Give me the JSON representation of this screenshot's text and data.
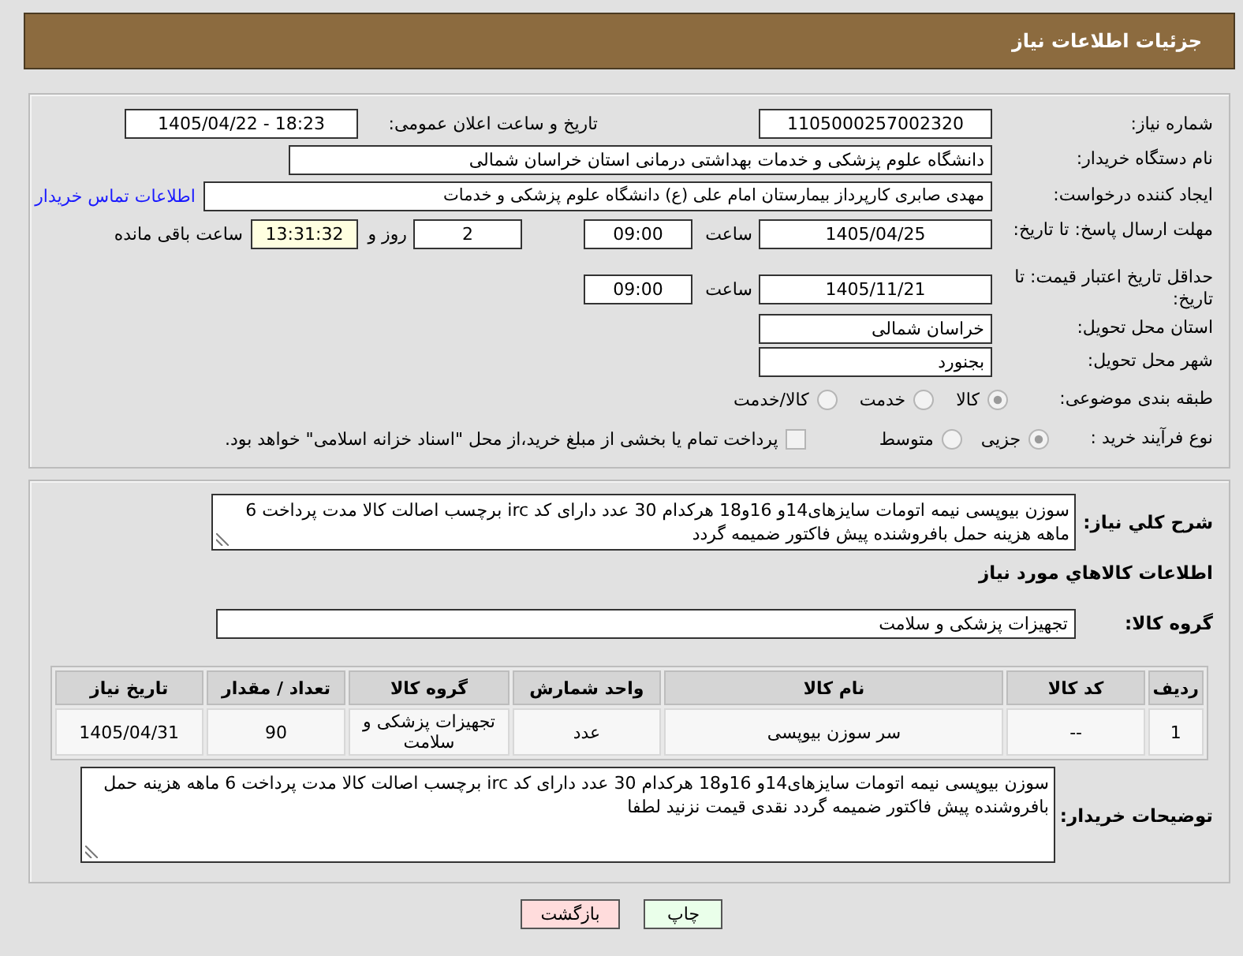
{
  "header": {
    "title": "جزئیات اطلاعات نیاز"
  },
  "details": {
    "need_number": {
      "label": "شماره نیاز:",
      "value": "1105000257002320"
    },
    "announce_datetime": {
      "label": "تاریخ و ساعت اعلان عمومی:",
      "value": "1405/04/22 - 18:23"
    },
    "buyer_org": {
      "label": "نام دستگاه خریدار:",
      "value": "دانشگاه علوم پزشکی و خدمات بهداشتی درمانی استان خراسان شمالی"
    },
    "requester": {
      "label": "ایجاد کننده درخواست:",
      "value": "مهدی صابری کارپرداز بیمارستان امام علی (ع) دانشگاه علوم پزشکی و خدمات",
      "contact_link": "اطلاعات تماس خریدار"
    },
    "response_deadline": {
      "label": "مهلت ارسال پاسخ: تا تاریخ:",
      "date": "1405/04/25",
      "time_label": "ساعت",
      "time": "09:00",
      "days": "2",
      "days_label": "روز و",
      "remaining": "13:31:32",
      "remaining_label": "ساعت باقی مانده"
    },
    "price_validity": {
      "label": "حداقل تاریخ اعتبار قیمت: تا تاریخ:",
      "date": "1405/11/21",
      "time_label": "ساعت",
      "time": "09:00"
    },
    "delivery_province": {
      "label": "استان محل تحویل:",
      "value": "خراسان شمالی"
    },
    "delivery_city": {
      "label": "شهر محل تحویل:",
      "value": "بجنورد"
    },
    "category": {
      "label": "طبقه بندی موضوعی:",
      "options": [
        {
          "label": "کالا",
          "selected": true
        },
        {
          "label": "خدمت",
          "selected": false
        },
        {
          "label": "کالا/خدمت",
          "selected": false
        }
      ]
    },
    "purchase_type": {
      "label": "نوع فرآیند خرید :",
      "options": [
        {
          "label": "جزیی",
          "selected": true
        },
        {
          "label": "متوسط",
          "selected": false
        }
      ],
      "treasury_payment": {
        "label": "پرداخت تمام یا بخشی از مبلغ خرید،از محل \"اسناد خزانه اسلامی\" خواهد بود.",
        "checked": false
      }
    }
  },
  "description": {
    "label": "شرح کلي نیاز:",
    "text": "سوزن بیوپسی نیمه اتومات سایزهای14و 16و18 هرکدام 30 عدد دارای کد irc برچسب اصالت کالا مدت پرداخت 6 ماهه هزینه حمل بافروشنده پیش فاکتور ضمیمه گردد"
  },
  "goods": {
    "title": "اطلاعات کالاهاي مورد نياز",
    "group_label": "گروه کالا:",
    "group": "تجهیزات پزشکی و سلامت",
    "table": {
      "columns": [
        "ردیف",
        "کد کالا",
        "نام کالا",
        "واحد شمارش",
        "گروه کالا",
        "تعداد / مقدار",
        "تاریخ نیاز"
      ],
      "rows": [
        [
          "1",
          "--",
          "سر سوزن بیوپسی",
          "عدد",
          "تجهیزات پزشکی و سلامت",
          "90",
          "1405/04/31"
        ]
      ]
    }
  },
  "buyer_notes": {
    "label": "توضیحات خریدار:",
    "text": "سوزن بیوپسی نیمه اتومات سایزهای14و 16و18 هرکدام 30 عدد دارای کد irc برچسب اصالت کالا مدت پرداخت 6 ماهه هزینه حمل بافروشنده پیش فاکتور ضمیمه گردد نقدی قیمت نزنید لطفا"
  },
  "buttons": [
    {
      "label": "چاپ",
      "kind": "print"
    },
    {
      "label": "بازگشت",
      "kind": "back"
    }
  ]
}
